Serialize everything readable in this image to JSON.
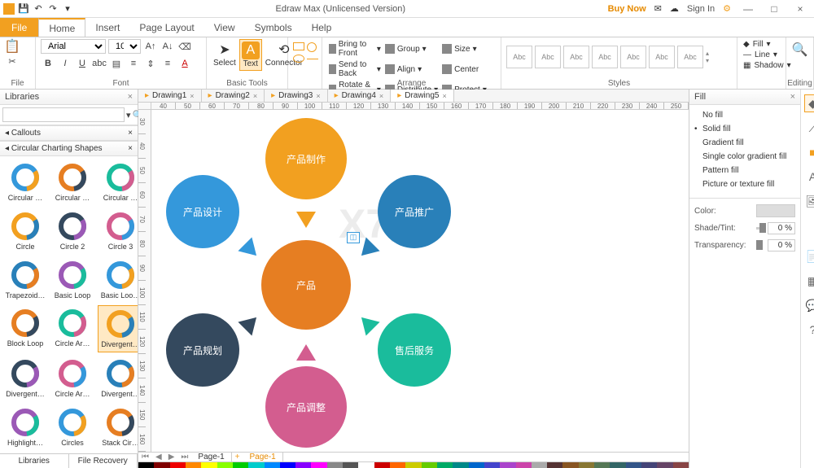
{
  "app": {
    "title": "Edraw Max (Unlicensed Version)"
  },
  "titlebar": {
    "buy": "Buy Now",
    "signin": "Sign In"
  },
  "menu": {
    "file": "File",
    "tabs": [
      "Home",
      "Insert",
      "Page Layout",
      "View",
      "Symbols",
      "Help"
    ],
    "active": "Home"
  },
  "ribbon": {
    "file_label": "File",
    "font_label": "Font",
    "tools_label": "Basic Tools",
    "arrange_label": "Arrange",
    "styles_label": "Styles",
    "edit_label": "Editing",
    "font_name": "Arial",
    "font_size": "10",
    "select": "Select",
    "text": "Text",
    "connector": "Connector",
    "bring_front": "Bring to Front",
    "send_back": "Send to Back",
    "rotate": "Rotate & Flip",
    "group": "Group",
    "align": "Align",
    "distribute": "Distribute",
    "size": "Size",
    "center": "Center",
    "protect": "Protect",
    "style_item": "Abc",
    "fill": "Fill",
    "line": "Line",
    "shadow": "Shadow"
  },
  "libraries": {
    "title": "Libraries",
    "cat1": "Callouts",
    "cat2": "Circular Charting Shapes",
    "tab1": "Libraries",
    "tab2": "File Recovery",
    "shapes": [
      "Circular …",
      "Circular …",
      "Circular …",
      "Circle",
      "Circle 2",
      "Circle 3",
      "Trapezoid…",
      "Basic Loop",
      "Basic Loo…",
      "Block Loop",
      "Circle Ar…",
      "Divergent…",
      "Divergent…",
      "Circle Ar…",
      "Divergent…",
      "Highlight…",
      "Circles",
      "Stack Cir…"
    ]
  },
  "docs": {
    "tabs": [
      "Drawing1",
      "Drawing2",
      "Drawing3",
      "Drawing4",
      "Drawing5"
    ],
    "active": 4
  },
  "ruler": [
    "40",
    "50",
    "60",
    "70",
    "80",
    "90",
    "100",
    "110",
    "120",
    "130",
    "140",
    "150",
    "160",
    "170",
    "180",
    "190",
    "200",
    "210",
    "220",
    "230",
    "240",
    "250"
  ],
  "ruler_v": [
    "30",
    "40",
    "50",
    "60",
    "70",
    "80",
    "90",
    "100",
    "110",
    "120",
    "130",
    "140",
    "150",
    "160"
  ],
  "diagram": {
    "center": "产品",
    "top": "产品制作",
    "tl": "产品设计",
    "tr": "产品推广",
    "bl": "产品规划",
    "br": "售后服务",
    "bot": "产品调整"
  },
  "pages": {
    "p1": "Page-1",
    "p2": "Page-1"
  },
  "fill": {
    "title": "Fill",
    "opts": [
      "No fill",
      "Solid fill",
      "Gradient fill",
      "Single color gradient fill",
      "Pattern fill",
      "Picture or texture fill"
    ],
    "color": "Color:",
    "shade": "Shade/Tint:",
    "trans": "Transparency:",
    "pct": "0 %"
  },
  "fill_colors": [
    "#000",
    "#7f0000",
    "#e00",
    "#f80",
    "#ff0",
    "#8f0",
    "#0c0",
    "#0cc",
    "#08f",
    "#00f",
    "#80f",
    "#f0f",
    "#888",
    "#555",
    "#fff",
    "#c00",
    "#f60",
    "#cc0",
    "#6c0",
    "#0a6",
    "#088",
    "#06c",
    "#44c",
    "#a4c",
    "#c4a",
    "#aaa",
    "#533",
    "#852",
    "#873",
    "#575",
    "#366",
    "#358",
    "#447",
    "#646",
    "#844"
  ]
}
